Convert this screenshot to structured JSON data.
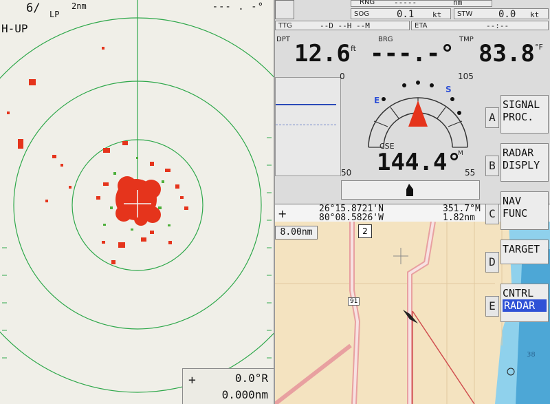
{
  "radar": {
    "range": "6/",
    "pulse": "LP",
    "ring_scale": "2nm",
    "orientation": "H-UP",
    "top_right": "--- . -°",
    "cursor_bearing": "0.0°R",
    "cursor_range": "0.000nm"
  },
  "header": {
    "rng_label": "RNG",
    "rng_value": "-----",
    "rng_unit": "nm",
    "sog_label": "SOG",
    "sog_value": "0.1",
    "sog_unit": "kt",
    "stw_label": "STW",
    "stw_value": "0.0",
    "stw_unit": "kt",
    "ttg_label": "TTG",
    "ttg_value": "--D --H --M",
    "eta_label": "ETA",
    "eta_value": "--:--"
  },
  "instruments": {
    "dpt_label": "DPT",
    "dpt_value": "12.6",
    "dpt_unit": "ft",
    "brg_label": "BRG",
    "brg_value": "---.-°",
    "tmp_label": "TMP",
    "tmp_value": "83.8",
    "tmp_unit": "°F",
    "cse_label": "CSE",
    "cse_value": "144.4°",
    "cse_unit": "M",
    "scale_left_top": "0",
    "scale_right_top": "105",
    "scale_left_bottom": "50",
    "scale_right_bottom": "55",
    "compass_e": "E",
    "compass_s": "S"
  },
  "position": {
    "lat": "26°15.8721'N",
    "lon": "80°08.5826'W",
    "bearing": "351.7°M",
    "distance": "1.82nm"
  },
  "softkeys": [
    {
      "key": "A",
      "line1": "SIGNAL",
      "line2": "PROC."
    },
    {
      "key": "B",
      "line1": "RADAR",
      "line2": "DISPLY"
    },
    {
      "key": "C",
      "line1": "NAV",
      "line2": "FUNC"
    },
    {
      "key": "D",
      "line1": "TARGET",
      "line2": ""
    },
    {
      "key": "E",
      "line1": "CNTRL",
      "line2": "RADAR"
    }
  ],
  "chart": {
    "range": "8.00nm",
    "route_marker": "2",
    "road_label": "91",
    "depth_label": "38"
  },
  "colors": {
    "radar_echo": "#e5341c",
    "radar_ring": "#2fa84b",
    "cursor_select": "#2f51d6"
  }
}
